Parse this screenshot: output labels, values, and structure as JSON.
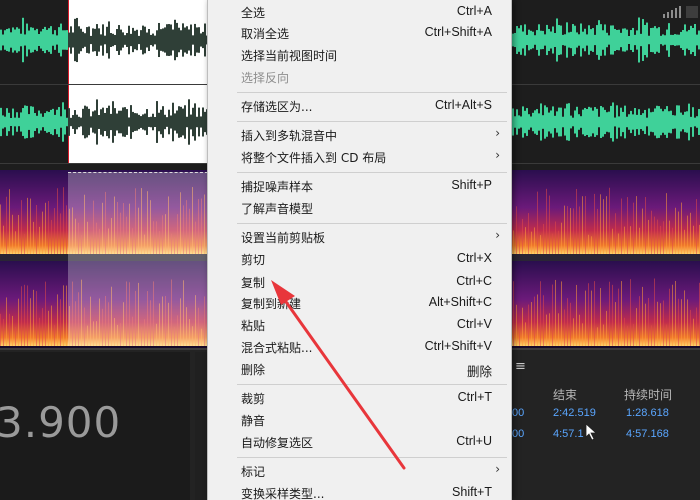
{
  "context_menu": {
    "items": [
      {
        "label": "全选",
        "shortcut": "Ctrl+A"
      },
      {
        "label": "取消全选",
        "shortcut": "Ctrl+Shift+A"
      },
      {
        "label": "选择当前视图时间",
        "shortcut": ""
      },
      {
        "label": "选择反向",
        "shortcut": "",
        "disabled": true
      },
      {
        "label": "存储选区为...",
        "shortcut": "Ctrl+Alt+S"
      },
      {
        "label": "插入到多轨混音中",
        "shortcut": "",
        "submenu": true
      },
      {
        "label": "将整个文件插入到 CD 布局",
        "shortcut": "",
        "submenu": true
      },
      {
        "label": "捕捉噪声样本",
        "shortcut": "Shift+P"
      },
      {
        "label": "了解声音模型",
        "shortcut": ""
      },
      {
        "label": "设置当前剪贴板",
        "shortcut": "",
        "submenu": true
      },
      {
        "label": "剪切",
        "shortcut": "Ctrl+X"
      },
      {
        "label": "复制",
        "shortcut": "Ctrl+C"
      },
      {
        "label": "复制到新建",
        "shortcut": "Alt+Shift+C"
      },
      {
        "label": "粘贴",
        "shortcut": "Ctrl+V"
      },
      {
        "label": "混合式粘贴...",
        "shortcut": "Ctrl+Shift+V"
      },
      {
        "label": "删除",
        "shortcut": "删除"
      },
      {
        "label": "裁剪",
        "shortcut": "Ctrl+T"
      },
      {
        "label": "静音",
        "shortcut": ""
      },
      {
        "label": "自动修复选区",
        "shortcut": "Ctrl+U"
      },
      {
        "label": "标记",
        "shortcut": "",
        "submenu": true
      },
      {
        "label": "变换采样类型...",
        "shortcut": "Shift+T"
      }
    ],
    "submenu_glyph": "›"
  },
  "time_display": {
    "value": "3.900"
  },
  "selection_panel": {
    "menu_glyph": "≡",
    "headers": {
      "end": "结束",
      "duration": "持续时间"
    },
    "rows": [
      {
        "start_fragment": "00",
        "end": "2:42.519",
        "duration": "1:28.618"
      },
      {
        "start_fragment": "00",
        "end": "4:57.1",
        "duration": "4:57.168"
      }
    ]
  },
  "colors": {
    "waveform": "#3fd199",
    "selected_waveform": "#2f3f37",
    "selection_border": "#d81b2a",
    "annotation_arrow": "#e8363b",
    "time_value": "#5aa6ff"
  }
}
